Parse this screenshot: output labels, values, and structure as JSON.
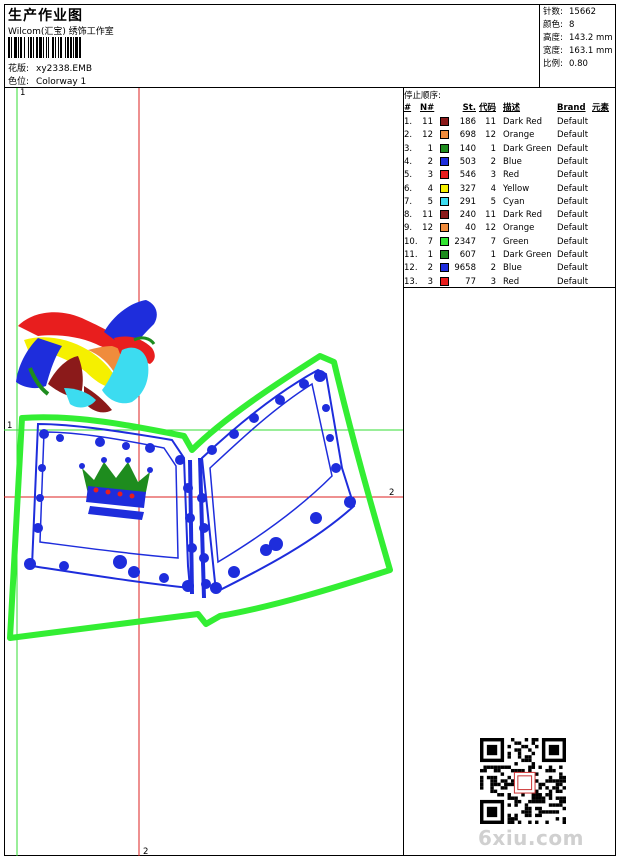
{
  "header": {
    "title": "生产作业图",
    "company": "Wilcom(汇宝) 绣饰工作室",
    "design_label": "花版:",
    "design_value": "xy2338.EMB",
    "colorway_label": "色位:",
    "colorway_value": "Colorway 1"
  },
  "stats": [
    {
      "label": "针数:",
      "value": "15662"
    },
    {
      "label": "颜色:",
      "value": "8"
    },
    {
      "label": "高度:",
      "value": "143.2 mm"
    },
    {
      "label": "宽度:",
      "value": "163.1 mm"
    },
    {
      "label": "比例:",
      "value": "0.80"
    }
  ],
  "colorstops": {
    "title": "停止顺序:",
    "headers": {
      "idx": "#",
      "num": "N#",
      "st": "St.",
      "code": "代码",
      "desc": "描述",
      "brand": "Brand",
      "element": "元素"
    },
    "rows": [
      {
        "idx": "1.",
        "num": "11",
        "color": "#8b1a1a",
        "st": "186",
        "code": "11",
        "desc": "Dark Red",
        "brand": "Default"
      },
      {
        "idx": "2.",
        "num": "12",
        "color": "#f08c3c",
        "st": "698",
        "code": "12",
        "desc": "Orange",
        "brand": "Default"
      },
      {
        "idx": "3.",
        "num": "1",
        "color": "#1e8c1e",
        "st": "140",
        "code": "1",
        "desc": "Dark Green",
        "brand": "Default"
      },
      {
        "idx": "4.",
        "num": "2",
        "color": "#1e2ddc",
        "st": "503",
        "code": "2",
        "desc": "Blue",
        "brand": "Default"
      },
      {
        "idx": "5.",
        "num": "3",
        "color": "#e81e1e",
        "st": "546",
        "code": "3",
        "desc": "Red",
        "brand": "Default"
      },
      {
        "idx": "6.",
        "num": "4",
        "color": "#f5f000",
        "st": "327",
        "code": "4",
        "desc": "Yellow",
        "brand": "Default"
      },
      {
        "idx": "7.",
        "num": "5",
        "color": "#3cdcf0",
        "st": "291",
        "code": "5",
        "desc": "Cyan",
        "brand": "Default"
      },
      {
        "idx": "8.",
        "num": "11",
        "color": "#8b1a1a",
        "st": "240",
        "code": "11",
        "desc": "Dark Red",
        "brand": "Default"
      },
      {
        "idx": "9.",
        "num": "12",
        "color": "#f08c3c",
        "st": "40",
        "code": "12",
        "desc": "Orange",
        "brand": "Default"
      },
      {
        "idx": "10.",
        "num": "7",
        "color": "#32e632",
        "st": "2347",
        "code": "7",
        "desc": "Green",
        "brand": "Default"
      },
      {
        "idx": "11.",
        "num": "1",
        "color": "#1e8c1e",
        "st": "607",
        "code": "1",
        "desc": "Dark Green",
        "brand": "Default"
      },
      {
        "idx": "12.",
        "num": "2",
        "color": "#1e2ddc",
        "st": "9658",
        "code": "2",
        "desc": "Blue",
        "brand": "Default"
      },
      {
        "idx": "13.",
        "num": "3",
        "color": "#e81e1e",
        "st": "77",
        "code": "3",
        "desc": "Red",
        "brand": "Default"
      }
    ]
  },
  "axes": {
    "v1": "1",
    "h1": "1",
    "v2": "2",
    "h2": "2"
  },
  "watermark": "6xiu.com",
  "colors": {
    "guide_green": "#33dd33",
    "guide_red": "#dd2222",
    "book_outline": "#33ee33",
    "stitch_blue": "#1e2ddc"
  }
}
